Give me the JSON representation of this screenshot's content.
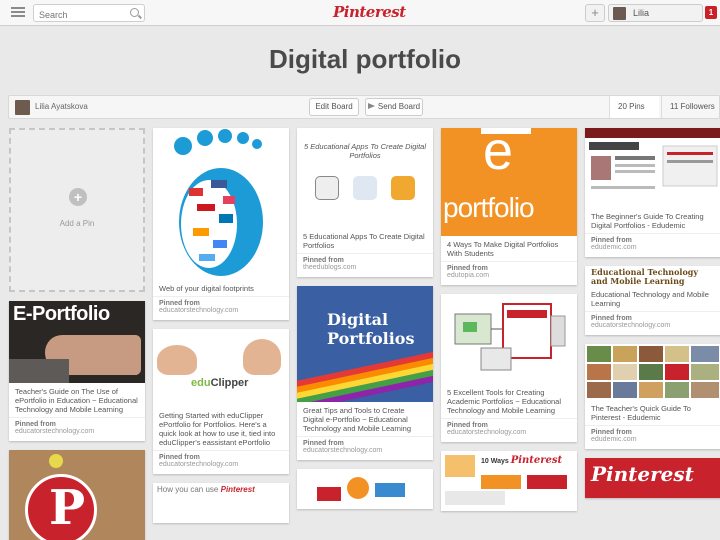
{
  "header": {
    "search_placeholder": "Search",
    "logo": "Pinterest",
    "user_name": "Lilia",
    "notifications": "1",
    "add_symbol": "+"
  },
  "board": {
    "title": "Digital portfolio",
    "owner": "Lilia Ayatskova",
    "edit_label": "Edit Board",
    "send_label": "Send Board",
    "pins_count": "20 Pins",
    "followers_count": "11 Followers"
  },
  "add_pin": {
    "symbol": "+",
    "label": "Add a Pin"
  },
  "pinned_from": "Pinned from",
  "pins": {
    "c1": [
      {
        "image_title": "E-Portfolio",
        "desc": "Teacher's Guide on The Use of ePortfolio in Education ~ Educational Technology and Mobile Learning",
        "source": "educatorstechnology.com"
      },
      {
        "image_letter": "P"
      }
    ],
    "c2": [
      {
        "desc": "Web of your digital footprints",
        "source": "educatorstechnology.com"
      },
      {
        "image_word_1": "edu",
        "image_word_2": "Clipper",
        "desc": "Getting Started with eduClipper ePortfolio for Portfolios. Here's a quick look at how to use it, tied into eduClipper's eassistant ePortfolio",
        "source": "educatorstechnology.com"
      },
      {
        "image_title": "How you can use",
        "image_brand": "Pinterest"
      }
    ],
    "c3": [
      {
        "image_caption": "5 Educational Apps To Create Digital Portfolios",
        "desc": "5 Educational Apps To Create Digital Portfolios",
        "source": "theedublogs.com"
      },
      {
        "image_title_1": "Digital",
        "image_title_2": "Portfolios",
        "desc": "Great Tips and Tools to Create Digital e-Portfolio ~ Educational Technology and Mobile Learning",
        "source": "educatorstechnology.com"
      }
    ],
    "c4": [
      {
        "image_letter": "e",
        "image_word": "portfolio",
        "desc": "4 Ways To Make Digital Portfolios With Students",
        "source": "edutopia.com"
      },
      {
        "desc": "5 Excellent Tools for Creating Academic Portfolios ~ Educational Technology and Mobile Learning",
        "source": "educatorstechnology.com"
      },
      {
        "image_title": "10 Ways",
        "image_brand": "Pinterest"
      }
    ],
    "c5": [
      {
        "desc": "The Beginner's Guide To Creating Digital Portfolios - Edudemic",
        "source": "edudemic.com"
      },
      {
        "heading": "Educational Technology and Mobile Learning",
        "desc": "Educational Technology and Mobile Learning",
        "source": "educatorstechnology.com"
      },
      {
        "desc": "The Teacher's Quick Guide To Pinterest - Edudemic",
        "source": "edudemic.com"
      },
      {
        "image_title": "Pinterest"
      }
    ]
  }
}
